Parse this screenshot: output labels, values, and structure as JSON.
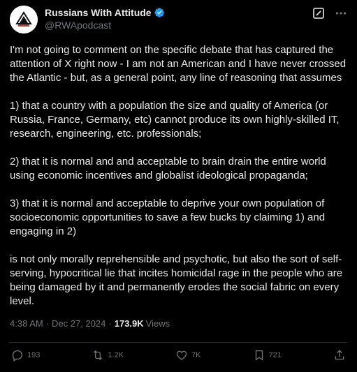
{
  "author": {
    "display_name": "Russians With Attitude",
    "handle": "@RWApodcast",
    "verified": true,
    "avatar_icon": "podcast-logo-icon"
  },
  "header_actions": {
    "grok_icon": "grok-icon",
    "more_icon": "more-dots-icon"
  },
  "tweet": {
    "text": "I'm not going to comment on the specific debate that has captured the attention of X right now - I am not an American and I have never crossed the Atlantic - but, as a general point, any line of reasoning that assumes\n\n1) that a country with a population the size and quality of America (or Russia, France, Germany, etc) cannot produce its own highly-skilled IT, research, engineering, etc. professionals;\n\n2) that it is normal and and acceptable to brain drain the entire world using economic incentives and globalist ideological propaganda;\n\n3) that it is normal and acceptable to deprive your own population of socioeconomic opportunities to save a few bucks by claiming 1) and engaging in 2)\n\nis not only morally reprehensible and psychotic, but also the sort of self-serving, hypocritical lie that incites homicidal rage in the people who are being damaged by it and permanently erodes the social fabric on every level.",
    "time": "4:38 AM",
    "separator": "·",
    "date": "Dec 27, 2024",
    "views_count": "173.9K",
    "views_label": "Views"
  },
  "actions": {
    "replies": "193",
    "reposts": "1.2K",
    "likes": "7K",
    "bookmarks": "721"
  },
  "colors": {
    "background": "#000000",
    "text": "#e7e9ea",
    "muted": "#71767b",
    "divider": "#2f3336",
    "verified": "#1d9bf0"
  }
}
